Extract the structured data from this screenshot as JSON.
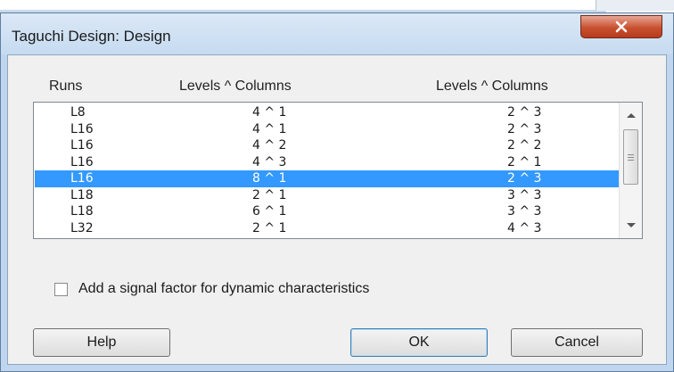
{
  "window": {
    "title": "Taguchi Design: Design"
  },
  "columns": {
    "runs": "Runs",
    "levels_columns_1": "Levels ^ Columns",
    "levels_columns_2": "Levels ^ Columns"
  },
  "rows": [
    {
      "runs": "L8",
      "lc1": "4 ^ 1",
      "lc2": "2 ^ 3"
    },
    {
      "runs": "L16",
      "lc1": "4 ^ 1",
      "lc2": "2 ^ 3"
    },
    {
      "runs": "L16",
      "lc1": "4 ^ 2",
      "lc2": "2 ^ 2"
    },
    {
      "runs": "L16",
      "lc1": "4 ^ 3",
      "lc2": "2 ^ 1"
    },
    {
      "runs": "L16",
      "lc1": "8 ^ 1",
      "lc2": "2 ^ 3"
    },
    {
      "runs": "L18",
      "lc1": "2 ^ 1",
      "lc2": "3 ^ 3"
    },
    {
      "runs": "L18",
      "lc1": "6 ^ 1",
      "lc2": "3 ^ 3"
    },
    {
      "runs": "L32",
      "lc1": "2 ^ 1",
      "lc2": "4 ^ 3"
    }
  ],
  "selected_row_index": 4,
  "checkbox": {
    "label": "Add a signal factor for dynamic characteristics",
    "checked": false
  },
  "buttons": {
    "help": "Help",
    "ok": "OK",
    "cancel": "Cancel"
  },
  "icons": {
    "close": "close-icon",
    "scroll_up": "scroll-up-arrow-icon",
    "scroll_down": "scroll-down-arrow-icon"
  },
  "colors": {
    "selection": "#3399ff",
    "close_button": "#c9502f"
  }
}
